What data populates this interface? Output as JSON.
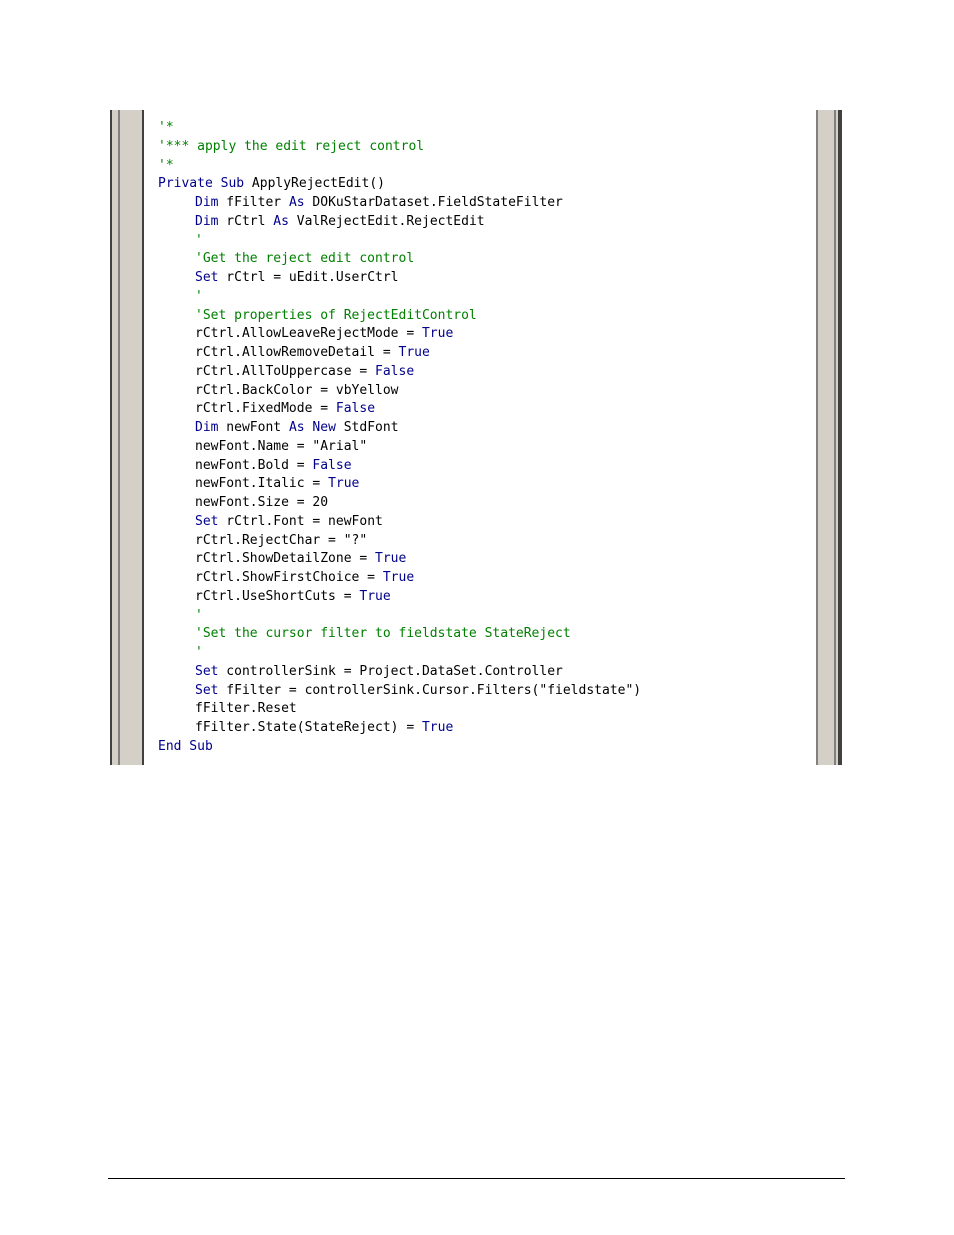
{
  "code_lines": [
    {
      "indent": 0,
      "tokens": [
        {
          "t": "'*",
          "c": "c"
        }
      ]
    },
    {
      "indent": 0,
      "tokens": [
        {
          "t": "'*** apply the edit reject control",
          "c": "c"
        }
      ]
    },
    {
      "indent": 0,
      "tokens": [
        {
          "t": "'*",
          "c": "c"
        }
      ]
    },
    {
      "indent": 0,
      "tokens": [
        {
          "t": "Private Sub",
          "c": "k"
        },
        {
          "t": " ApplyRejectEdit()",
          "c": ""
        }
      ]
    },
    {
      "indent": 1,
      "tokens": [
        {
          "t": "Dim",
          "c": "k"
        },
        {
          "t": " fFilter ",
          "c": ""
        },
        {
          "t": "As",
          "c": "k"
        },
        {
          "t": " DOKuStarDataset.FieldStateFilter",
          "c": ""
        }
      ]
    },
    {
      "indent": 1,
      "tokens": [
        {
          "t": "Dim",
          "c": "k"
        },
        {
          "t": " rCtrl ",
          "c": ""
        },
        {
          "t": "As",
          "c": "k"
        },
        {
          "t": " ValRejectEdit.RejectEdit",
          "c": ""
        }
      ]
    },
    {
      "indent": 1,
      "tokens": [
        {
          "t": "'",
          "c": "c"
        }
      ]
    },
    {
      "indent": 1,
      "tokens": [
        {
          "t": "'Get the reject edit control",
          "c": "c"
        }
      ]
    },
    {
      "indent": 1,
      "tokens": [
        {
          "t": "Set",
          "c": "k"
        },
        {
          "t": " rCtrl = uEdit.UserCtrl",
          "c": ""
        }
      ]
    },
    {
      "indent": 1,
      "tokens": [
        {
          "t": "'",
          "c": "c"
        }
      ]
    },
    {
      "indent": 1,
      "tokens": [
        {
          "t": "'Set properties of RejectEditControl",
          "c": "c"
        }
      ]
    },
    {
      "indent": 1,
      "tokens": [
        {
          "t": "rCtrl.AllowLeaveRejectMode = ",
          "c": ""
        },
        {
          "t": "True",
          "c": "k"
        }
      ]
    },
    {
      "indent": 1,
      "tokens": [
        {
          "t": "rCtrl.AllowRemoveDetail = ",
          "c": ""
        },
        {
          "t": "True",
          "c": "k"
        }
      ]
    },
    {
      "indent": 1,
      "tokens": [
        {
          "t": "rCtrl.AllToUppercase = ",
          "c": ""
        },
        {
          "t": "False",
          "c": "k"
        }
      ]
    },
    {
      "indent": 1,
      "tokens": [
        {
          "t": "rCtrl.BackColor = vbYellow",
          "c": ""
        }
      ]
    },
    {
      "indent": 1,
      "tokens": [
        {
          "t": "rCtrl.FixedMode = ",
          "c": ""
        },
        {
          "t": "False",
          "c": "k"
        }
      ]
    },
    {
      "indent": 1,
      "tokens": [
        {
          "t": "Dim",
          "c": "k"
        },
        {
          "t": " newFont ",
          "c": ""
        },
        {
          "t": "As New",
          "c": "k"
        },
        {
          "t": " StdFont",
          "c": ""
        }
      ]
    },
    {
      "indent": 1,
      "tokens": [
        {
          "t": "newFont.Name = \"Arial\"",
          "c": ""
        }
      ]
    },
    {
      "indent": 1,
      "tokens": [
        {
          "t": "newFont.Bold = ",
          "c": ""
        },
        {
          "t": "False",
          "c": "k"
        }
      ]
    },
    {
      "indent": 1,
      "tokens": [
        {
          "t": "newFont.Italic = ",
          "c": ""
        },
        {
          "t": "True",
          "c": "k"
        }
      ]
    },
    {
      "indent": 1,
      "tokens": [
        {
          "t": "newFont.Size = 20",
          "c": ""
        }
      ]
    },
    {
      "indent": 1,
      "tokens": [
        {
          "t": "Set",
          "c": "k"
        },
        {
          "t": " rCtrl.Font = newFont",
          "c": ""
        }
      ]
    },
    {
      "indent": 1,
      "tokens": [
        {
          "t": "rCtrl.RejectChar = \"?\"",
          "c": ""
        }
      ]
    },
    {
      "indent": 1,
      "tokens": [
        {
          "t": "rCtrl.ShowDetailZone = ",
          "c": ""
        },
        {
          "t": "True",
          "c": "k"
        }
      ]
    },
    {
      "indent": 1,
      "tokens": [
        {
          "t": "rCtrl.ShowFirstChoice = ",
          "c": ""
        },
        {
          "t": "True",
          "c": "k"
        }
      ]
    },
    {
      "indent": 1,
      "tokens": [
        {
          "t": "rCtrl.UseShortCuts = ",
          "c": ""
        },
        {
          "t": "True",
          "c": "k"
        }
      ]
    },
    {
      "indent": 1,
      "tokens": [
        {
          "t": "'",
          "c": "c"
        }
      ]
    },
    {
      "indent": 1,
      "tokens": [
        {
          "t": "'Set the cursor filter to fieldstate StateReject",
          "c": "c"
        }
      ]
    },
    {
      "indent": 1,
      "tokens": [
        {
          "t": "'",
          "c": "c"
        }
      ]
    },
    {
      "indent": 1,
      "tokens": [
        {
          "t": "Set",
          "c": "k"
        },
        {
          "t": " controllerSink = Project.DataSet.Controller",
          "c": ""
        }
      ]
    },
    {
      "indent": 1,
      "tokens": [
        {
          "t": "Set",
          "c": "k"
        },
        {
          "t": " fFilter = controllerSink.Cursor.Filters(\"fieldstate\")",
          "c": ""
        }
      ]
    },
    {
      "indent": 1,
      "tokens": [
        {
          "t": "fFilter.Reset",
          "c": ""
        }
      ]
    },
    {
      "indent": 1,
      "tokens": [
        {
          "t": "fFilter.State(StateReject) = ",
          "c": ""
        },
        {
          "t": "True",
          "c": "k"
        }
      ]
    },
    {
      "indent": 0,
      "tokens": [
        {
          "t": "End Sub",
          "c": "k"
        }
      ]
    }
  ],
  "colors": {
    "comment": "#008000",
    "keyword": "#00008b",
    "text": "#000000"
  }
}
